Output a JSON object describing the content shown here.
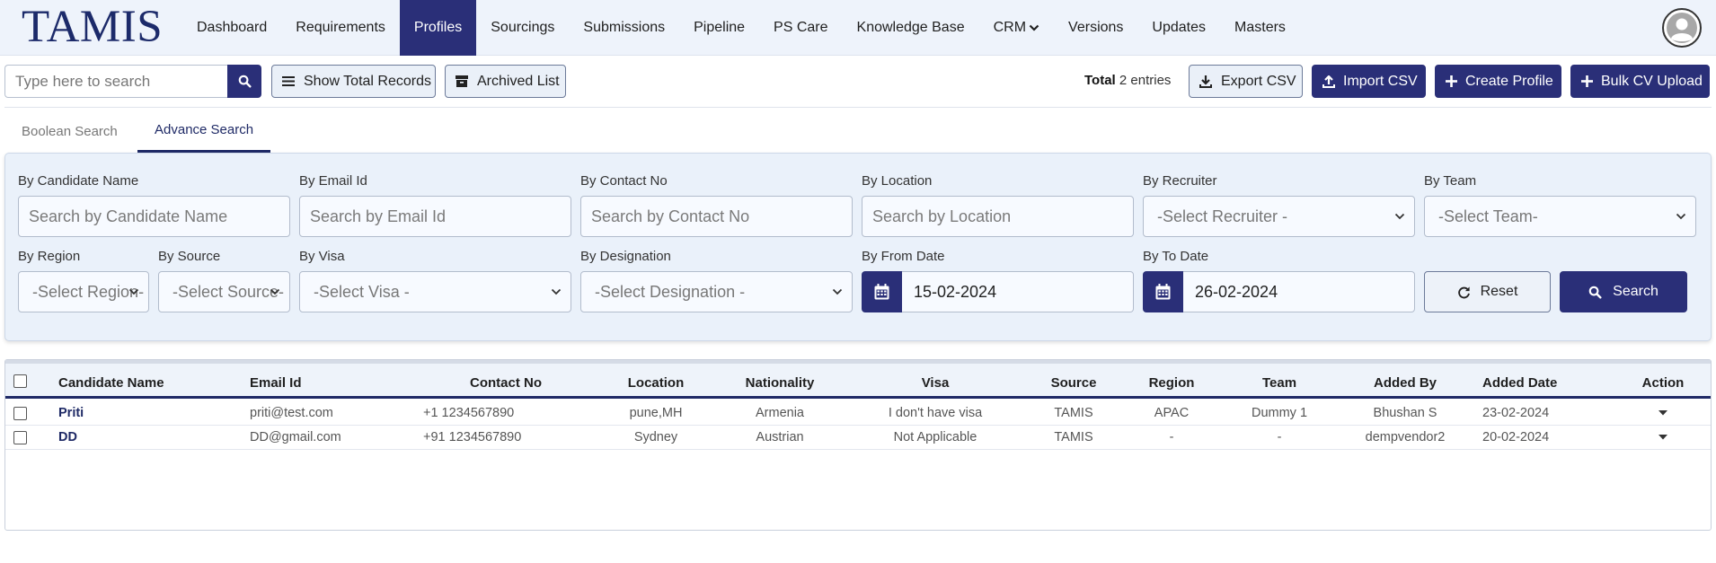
{
  "nav": {
    "logo": "TAMIS",
    "items": [
      "Dashboard",
      "Requirements",
      "Profiles",
      "Sourcings",
      "Submissions",
      "Pipeline",
      "PS Care",
      "Knowledge Base",
      "CRM",
      "Versions",
      "Updates",
      "Masters"
    ],
    "active": "Profiles"
  },
  "toolbar": {
    "search_placeholder": "Type here to search",
    "show_total_label": "Show Total Records",
    "archived_label": "Archived List",
    "total_label": "Total",
    "total_value": "2 entries",
    "export_label": "Export CSV",
    "import_label": "Import CSV",
    "create_label": "Create Profile",
    "bulk_label": "Bulk CV Upload"
  },
  "tabs": {
    "boolean": "Boolean Search",
    "advance": "Advance Search",
    "active": "Advance Search"
  },
  "filters": {
    "candidate_name": {
      "label": "By Candidate Name",
      "placeholder": "Search by Candidate Name"
    },
    "email": {
      "label": "By Email Id",
      "placeholder": "Search by Email Id"
    },
    "contact": {
      "label": "By Contact No",
      "placeholder": "Search by Contact No"
    },
    "location": {
      "label": "By Location",
      "placeholder": "Search by Location"
    },
    "recruiter": {
      "label": "By Recruiter",
      "selected": "-Select Recruiter -"
    },
    "team": {
      "label": "By Team",
      "selected": "-Select Team-"
    },
    "region": {
      "label": "By Region",
      "selected": "-Select Region-"
    },
    "source": {
      "label": "By Source",
      "selected": "-Select Source-"
    },
    "visa": {
      "label": "By Visa",
      "selected": "-Select Visa -"
    },
    "designation": {
      "label": "By Designation",
      "selected": "-Select Designation -"
    },
    "from_date": {
      "label": "By From Date",
      "value": "15-02-2024"
    },
    "to_date": {
      "label": "By To Date",
      "value": "26-02-2024"
    },
    "reset_label": "Reset",
    "search_label": "Search"
  },
  "table": {
    "columns": [
      "Candidate Name",
      "Email Id",
      "Contact No",
      "Location",
      "Nationality",
      "Visa",
      "Source",
      "Region",
      "Team",
      "Added By",
      "Added Date",
      "Action"
    ],
    "rows": [
      {
        "name": "Priti",
        "email": "priti@test.com",
        "contact": "+1 1234567890",
        "location": "pune,MH",
        "nationality": "Armenia",
        "visa": "I don't have visa",
        "source": "TAMIS",
        "region": "APAC",
        "team": "Dummy 1",
        "added_by": "Bhushan S",
        "added_date": "23-02-2024"
      },
      {
        "name": "DD",
        "email": "DD@gmail.com",
        "contact": "+91 1234567890",
        "location": "Sydney",
        "nationality": "Austrian",
        "visa": "Not Applicable",
        "source": "TAMIS",
        "region": "-",
        "team": "-",
        "added_by": "dempvendor2",
        "added_date": "20-02-2024"
      }
    ]
  },
  "colors": {
    "brand": "#2a2f78",
    "nav_bg": "#eef3fb",
    "panel_bg": "#eaf1fa"
  },
  "icons": [
    "search-icon",
    "list-icon",
    "archive-icon",
    "download-icon",
    "upload-icon",
    "plus-icon",
    "calendar-icon",
    "refresh-icon",
    "user-avatar-icon",
    "caret-down-icon"
  ]
}
